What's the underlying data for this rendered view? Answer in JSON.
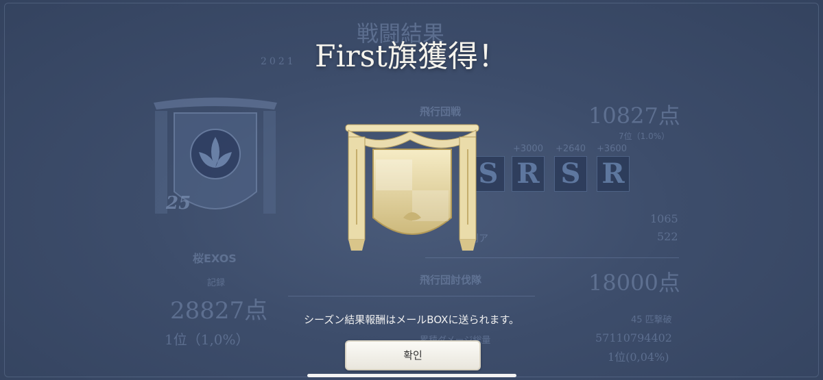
{
  "popup": {
    "headline": "First旗獲得！",
    "notice": "シーズン結果報酬はメールBOXに送られます。",
    "confirm_label": "확인"
  },
  "background": {
    "title": "戦闘結果",
    "date": "2021",
    "guild_name": "桜EXOS",
    "guild_level": "25",
    "record_label": "記録",
    "record_points": "28827点",
    "record_rank": "1位（1,0%）",
    "fleet_battle": {
      "label": "飛行団戦",
      "points": "10827点",
      "rank": "7位（1.0%）",
      "bonuses": [
        "+3000",
        "+2640",
        "+3600"
      ],
      "grades": [
        "S",
        "R",
        "S",
        "R"
      ],
      "score_rows": [
        {
          "label": "ア",
          "value": "1065"
        },
        {
          "label": "勝利ア",
          "value": "522"
        }
      ]
    },
    "subjugation": {
      "label": "飛行団討伐隊",
      "points": "18000点",
      "kills": "45 匹撃破",
      "damage_label": "累積ダメージ総量",
      "damage": "57110794402",
      "rank": "1位(0,04%)"
    }
  },
  "colors": {
    "background": "#3d4d6b",
    "banner_gold": "#e8d9a6",
    "button_bg": "#f7f5ef"
  }
}
